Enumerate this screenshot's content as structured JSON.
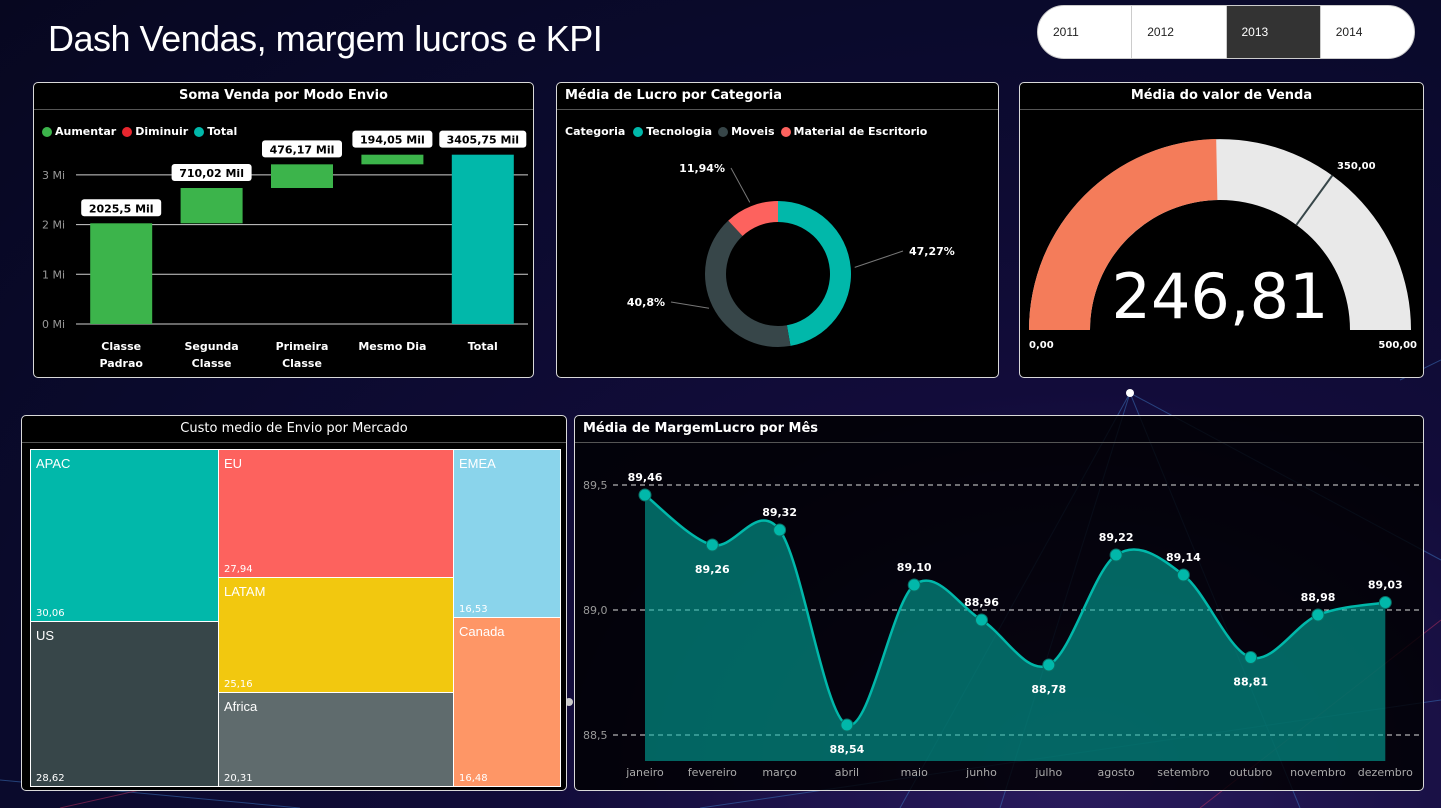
{
  "title": "Dash Vendas, margem lucros e KPI",
  "year_slicer": {
    "options": [
      "2011",
      "2012",
      "2013",
      "2014"
    ],
    "selected": "2013"
  },
  "waterfall": {
    "title": "Soma  Venda por Modo Envio",
    "legend": [
      {
        "label": "Aumentar",
        "color": "#3cb44b"
      },
      {
        "label": "Diminuir",
        "color": "#e8262e"
      },
      {
        "label": "Total",
        "color": "#01b8aa"
      }
    ],
    "y_ticks": [
      "0 Mi",
      "1 Mi",
      "2 Mi",
      "3 Mi"
    ]
  },
  "donut": {
    "title": "Média de Lucro por Categoria",
    "legend_title": "Categoria",
    "legend": [
      {
        "label": "Tecnologia",
        "color": "#01b8aa"
      },
      {
        "label": "Moveis",
        "color": "#374649"
      },
      {
        "label": "Material de Escritorio",
        "color": "#fd625e"
      }
    ]
  },
  "gauge": {
    "title": "Média do valor de Venda",
    "value_label": "246,81",
    "min_label": "0,00",
    "max_label": "500,00",
    "target_label": "350,00",
    "colors": {
      "fill": "#f47c5a",
      "rest": "#e9e9e9"
    }
  },
  "treemap": {
    "title": "Custo medio  de Envio por Mercado",
    "cells": [
      {
        "name": "APAC",
        "label": "30,06",
        "color": "#01b8aa"
      },
      {
        "name": "US",
        "label": "28,62",
        "color": "#374649"
      },
      {
        "name": "EU",
        "label": "27,94",
        "color": "#fd625e"
      },
      {
        "name": "LATAM",
        "label": "25,16",
        "color": "#f2c80f"
      },
      {
        "name": "Africa",
        "label": "20,31",
        "color": "#5f6b6d"
      },
      {
        "name": "EMEA",
        "label": "16,53",
        "color": "#8ad4eb"
      },
      {
        "name": "Canada",
        "label": "16,48",
        "color": "#fe9666"
      }
    ]
  },
  "area": {
    "title": "Média de MargemLucro por Mês"
  },
  "chart_data": [
    {
      "type": "bar",
      "subtype": "waterfall",
      "categories": [
        "Classe Padrao",
        "Segunda Classe",
        "Primeira Classe",
        "Mesmo Dia",
        "Total"
      ],
      "values": [
        2025.5,
        710.02,
        476.17,
        194.05,
        3405.75
      ],
      "data_labels": [
        "2025,5 Mil",
        "710,02 Mil",
        "476,17 Mil",
        "194,05 Mil",
        "3405,75 Mil"
      ],
      "kinds": [
        "increase",
        "increase",
        "increase",
        "increase",
        "total"
      ],
      "ylim": [
        0,
        3500
      ],
      "y_unit": "Mil",
      "grid": true,
      "legend_position": "top-left"
    },
    {
      "type": "pie",
      "subtype": "donut",
      "categories": [
        "Tecnologia",
        "Moveis",
        "Material de Escritorio"
      ],
      "values": [
        47.27,
        40.8,
        11.94
      ],
      "data_labels": [
        "47,27%",
        "40,8%",
        "11,94%"
      ],
      "legend_position": "top-left"
    },
    {
      "type": "area",
      "categories": [
        "janeiro",
        "fevereiro",
        "março",
        "abril",
        "maio",
        "junho",
        "julho",
        "agosto",
        "setembro",
        "outubro",
        "novembro",
        "dezembro"
      ],
      "values": [
        89.46,
        89.26,
        89.32,
        88.54,
        89.1,
        88.96,
        88.78,
        89.22,
        89.14,
        88.81,
        88.98,
        89.03
      ],
      "data_labels": [
        "89,46",
        "89,26",
        "89,32",
        "88,54",
        "89,10",
        "88,96",
        "88,78",
        "89,22",
        "89,14",
        "88,81",
        "88,98",
        "89,03"
      ],
      "y_ticks": [
        "88,5",
        "89,0",
        "89,5"
      ],
      "ylim": [
        88.4,
        89.6
      ],
      "grid": true,
      "color": "#01b8aa"
    }
  ]
}
